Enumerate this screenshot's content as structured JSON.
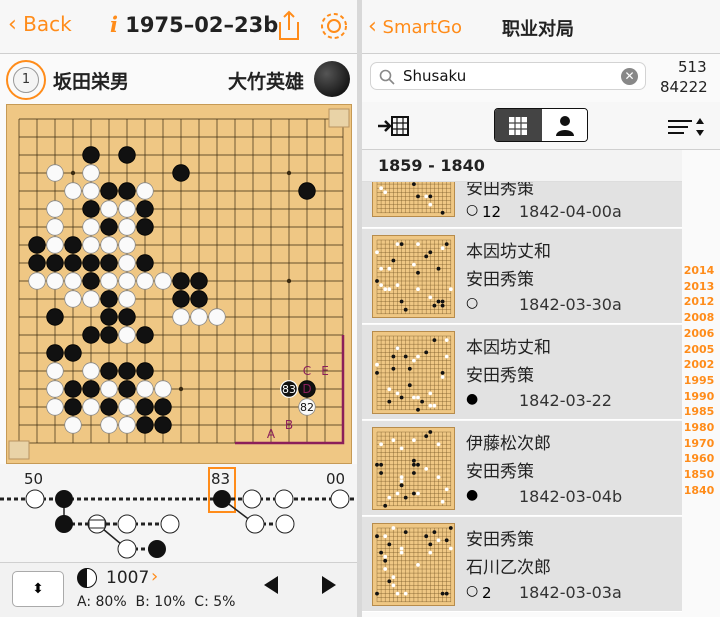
{
  "left": {
    "nav": {
      "back_label": "Back",
      "title": "1975–02–23b",
      "info_glyph": "i"
    },
    "players": {
      "move_badge": "1",
      "white_name": "坂田栄男",
      "black_name": "大竹英雄"
    },
    "board": {
      "size": 19,
      "labels": {
        "a": "A",
        "b": "B",
        "c": "C",
        "d": "D",
        "e": "E",
        "m83": "83",
        "m82": "82"
      }
    },
    "tree": {
      "left_num": "50",
      "center_num": "83",
      "right_num": "00"
    },
    "bottom": {
      "move_count": "1007",
      "stats": "A: 80%  B: 10%  C: 5%"
    }
  },
  "right": {
    "nav": {
      "back_label": "SmartGo",
      "title": "职业对局"
    },
    "search": {
      "value": "Shusaku",
      "count_top": "513",
      "count_bottom": "84222"
    },
    "section_title": "1859 - 1840",
    "rows": [
      {
        "p1": "安田秀策",
        "p2": "",
        "marker": "○",
        "moves": "12",
        "date": "1842-04-00a"
      },
      {
        "p1": "本因坊丈和",
        "p2": "安田秀策",
        "marker": "○",
        "moves": "",
        "date": "1842-03-30a"
      },
      {
        "p1": "本因坊丈和",
        "p2": "安田秀策",
        "marker": "●",
        "moves": "",
        "date": "1842-03-22"
      },
      {
        "p1": "伊藤松次郎",
        "p2": "安田秀策",
        "marker": "●",
        "moves": "",
        "date": "1842-03-04b"
      },
      {
        "p1": "安田秀策",
        "p2": "石川乙次郎",
        "marker": "○",
        "moves": "2",
        "date": "1842-03-03a"
      }
    ],
    "years": [
      "2014",
      "2013",
      "2012",
      "2008",
      "2006",
      "2005",
      "2002",
      "1995",
      "1990",
      "1985",
      "1980",
      "1970",
      "1960",
      "1850",
      "1840"
    ]
  },
  "colors": {
    "accent": "#ff8c1a",
    "board": "#efc784",
    "purple": "#8b1e5a"
  }
}
